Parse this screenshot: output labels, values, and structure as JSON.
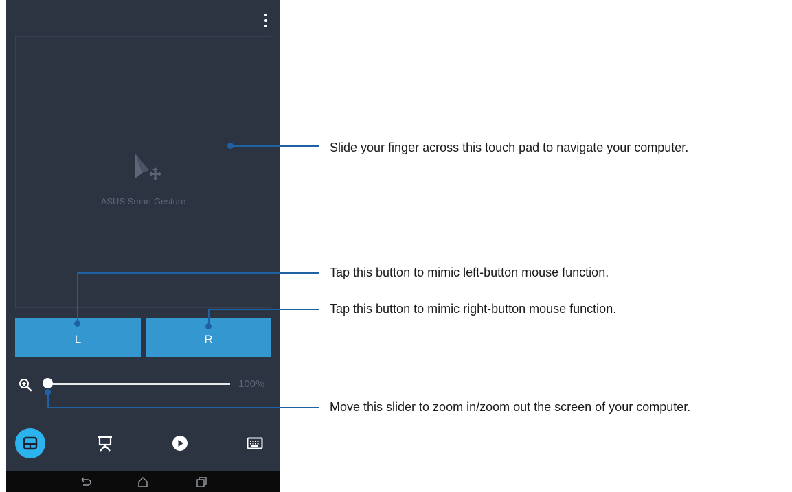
{
  "app": {
    "pad_label": "ASUS Smart Gesture",
    "left_button": "L",
    "right_button": "R",
    "zoom_percent": "100%",
    "zoom_level": 0,
    "nav": [
      {
        "icon": "touchpad-icon",
        "active": true
      },
      {
        "icon": "presentation-icon",
        "active": false
      },
      {
        "icon": "media-play-icon",
        "active": false
      },
      {
        "icon": "keyboard-icon",
        "active": false
      }
    ],
    "system_bar": [
      "back-icon",
      "home-icon",
      "recent-apps-icon"
    ]
  },
  "callouts": {
    "touchpad": "Slide your finger across this touch pad to navigate your computer.",
    "left_button": "Tap this button to mimic left-button mouse function.",
    "right_button": "Tap this button to mimic right-button mouse function.",
    "slider": "Move this slider to zoom in/zoom out the screen of your computer."
  },
  "colors": {
    "screen_bg": "#2c3341",
    "button_blue": "#3497d0",
    "active_nav": "#2cb3ee",
    "callout_line": "#1e62a3"
  }
}
